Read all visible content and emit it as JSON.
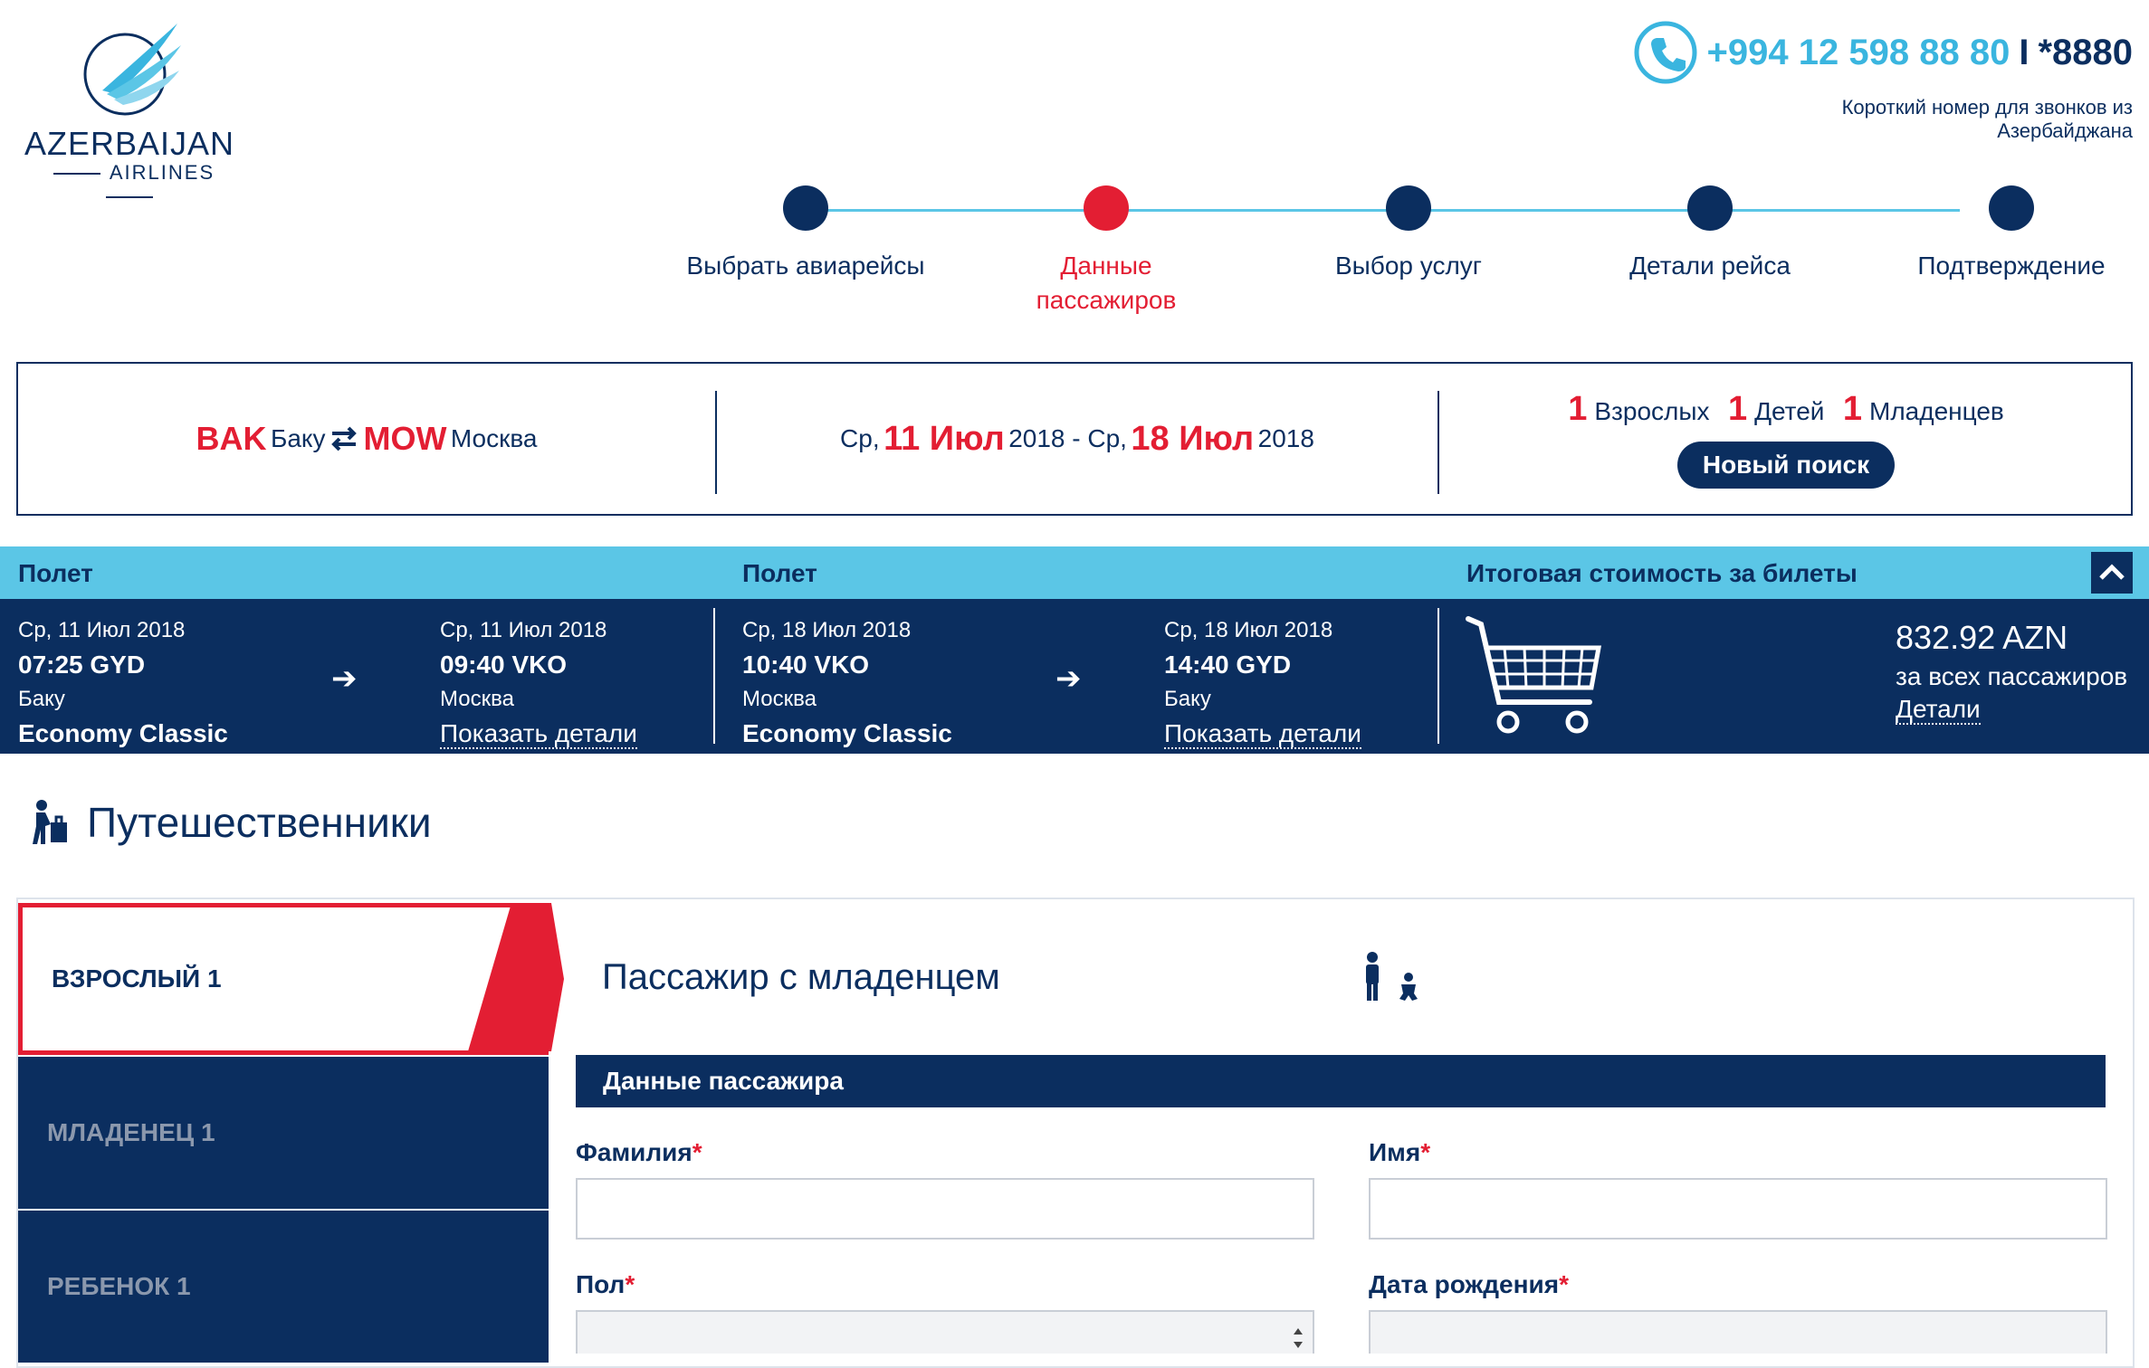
{
  "brand": {
    "name": "AZERBAIJAN",
    "sub": "AIRLINES"
  },
  "contact": {
    "phone": "+994 12 598 88 80",
    "separator": "I",
    "short_number": "*8880",
    "note": "Короткий номер для звонков из Азербайджана"
  },
  "steps": [
    {
      "label": "Выбрать авиарейсы"
    },
    {
      "label": "Данные пассажиров"
    },
    {
      "label": "Выбор услуг"
    },
    {
      "label": "Детали рейса"
    },
    {
      "label": "Подтверждение"
    }
  ],
  "search": {
    "from_code": "BAK",
    "from_city": "Баку",
    "to_code": "MOW",
    "to_city": "Москва",
    "dep_prefix": "Ср,",
    "dep_date": "11 Июл",
    "dep_year": "2018 - Ср,",
    "ret_date": "18 Июл",
    "ret_year": "2018",
    "adults_n": "1",
    "adults": "Взрослых",
    "children_n": "1",
    "children": "Детей",
    "infants_n": "1",
    "infants": "Младенцев",
    "new_search": "Новый поиск"
  },
  "flight_bar": {
    "col1": "Полет",
    "col2": "Полет",
    "col3": "Итоговая стоимость за билеты",
    "out": {
      "dep_date": "Ср, 11 Июл 2018",
      "dep_time": "07:25 GYD",
      "dep_city": "Баку",
      "cabin": "Economy Classic",
      "arr_date": "Ср, 11 Июл 2018",
      "arr_time": "09:40 VKO",
      "arr_city": "Москва",
      "details": "Показать детали"
    },
    "back": {
      "dep_date": "Ср, 18 Июл 2018",
      "dep_time": "10:40 VKO",
      "dep_city": "Москва",
      "cabin": "Economy Classic",
      "arr_date": "Ср, 18 Июл 2018",
      "arr_time": "14:40 GYD",
      "arr_city": "Баку",
      "details": "Показать детали"
    },
    "price": "832.92 AZN",
    "price_sub": "за всех пассажиров",
    "price_details": "Детали"
  },
  "travelers": {
    "title": "Путешественники",
    "tabs": [
      "ВЗРОСЛЫЙ 1",
      "МЛАДЕНЕЦ 1",
      "РЕБЕНОК 1"
    ],
    "passenger_title": "Пассажир с младенцем",
    "section": "Данные пассажира",
    "fields": {
      "lastname": "Фамилия",
      "firstname": "Имя",
      "gender": "Пол",
      "birthdate": "Дата рождения",
      "req": "*"
    }
  },
  "colors": {
    "navy": "#0b2e5f",
    "red": "#e31e33",
    "cyan": "#5bc6e6"
  }
}
